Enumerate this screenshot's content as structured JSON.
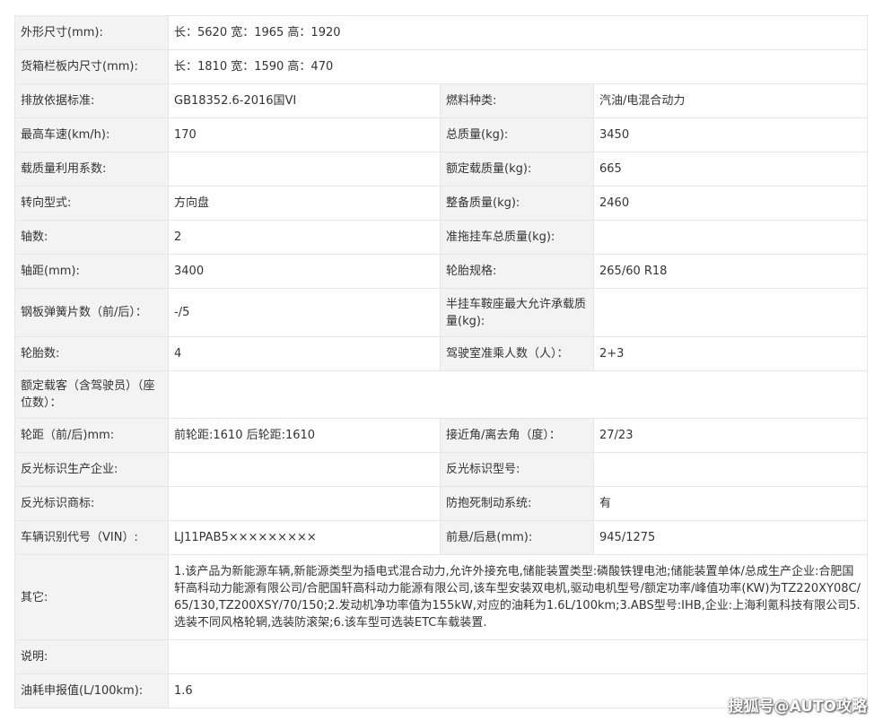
{
  "rows": [
    {
      "l1": "外形尺寸(mm):",
      "v1": "长：5620 宽：1965 高：1920"
    },
    {
      "l1": "货箱栏板内尺寸(mm):",
      "v1": "长：1810 宽：1590 高：470"
    },
    {
      "l1": "排放依据标准:",
      "v1": "GB18352.6-2016国VI",
      "l2": "燃料种类:",
      "v2": "汽油/电混合动力"
    },
    {
      "l1": "最高车速(km/h):",
      "v1": "170",
      "l2": "总质量(kg):",
      "v2": "3450"
    },
    {
      "l1": "载质量利用系数:",
      "v1": "",
      "l2": "额定载质量(kg):",
      "v2": "665"
    },
    {
      "l1": "转向型式:",
      "v1": "方向盘",
      "l2": "整备质量(kg):",
      "v2": "2460"
    },
    {
      "l1": "轴数:",
      "v1": "2",
      "l2": "准拖挂车总质量(kg):",
      "v2": ""
    },
    {
      "l1": "轴距(mm):",
      "v1": "3400",
      "l2": "轮胎规格:",
      "v2": "265/60 R18"
    },
    {
      "l1": "钢板弹簧片数（前/后）：",
      "v1": "-/5",
      "l2": "半挂车鞍座最大允许承载质量(kg):",
      "v2": ""
    },
    {
      "l1": "轮胎数:",
      "v1": "4",
      "l2": "驾驶室准乘人数（人）：",
      "v2": "2+3"
    },
    {
      "l1": "额定载客（含驾驶员）（座位数）：",
      "v1": ""
    },
    {
      "l1": "轮距（前/后)mm:",
      "v1": "前轮距:1610 后轮距:1610",
      "l2": "接近角/离去角（度）：",
      "v2": "27/23"
    },
    {
      "l1": "反光标识生产企业:",
      "v1": "",
      "l2": "反光标识型号:",
      "v2": ""
    },
    {
      "l1": "反光标识商标:",
      "v1": "",
      "l2": "防抱死制动系统:",
      "v2": "有"
    },
    {
      "l1": "车辆识别代号（VIN）:",
      "v1": "LJ11PAB5×××××××××",
      "l2": "前悬/后悬(mm):",
      "v2": "945/1275"
    },
    {
      "l1": "其它:",
      "v1": "1.该产品为新能源车辆,新能源类型为插电式混合动力,允许外接充电,储能装置类型:磷酸铁锂电池;储能装置单体/总成生产企业:合肥国轩高科动力能源有限公司/合肥国轩高科动力能源有限公司,该车型安装双电机,驱动电机型号/额定功率/峰值功率(KW)为TZ220XY08C/65/130,TZ200XSY/70/150;2.发动机净功率值为155kW,对应的油耗为1.6L/100km;3.ABS型号:IHB,企业:上海利氪科技有限公司5.选装不同风格轮辋,选装防滚架;6.该车型可选装ETC车载装置."
    },
    {
      "l1": "说明:",
      "v1": ""
    },
    {
      "l1": "油耗申报值(L/100km):",
      "v1": "1.6"
    }
  ],
  "watermark": "搜狐号@AUTO攻略"
}
